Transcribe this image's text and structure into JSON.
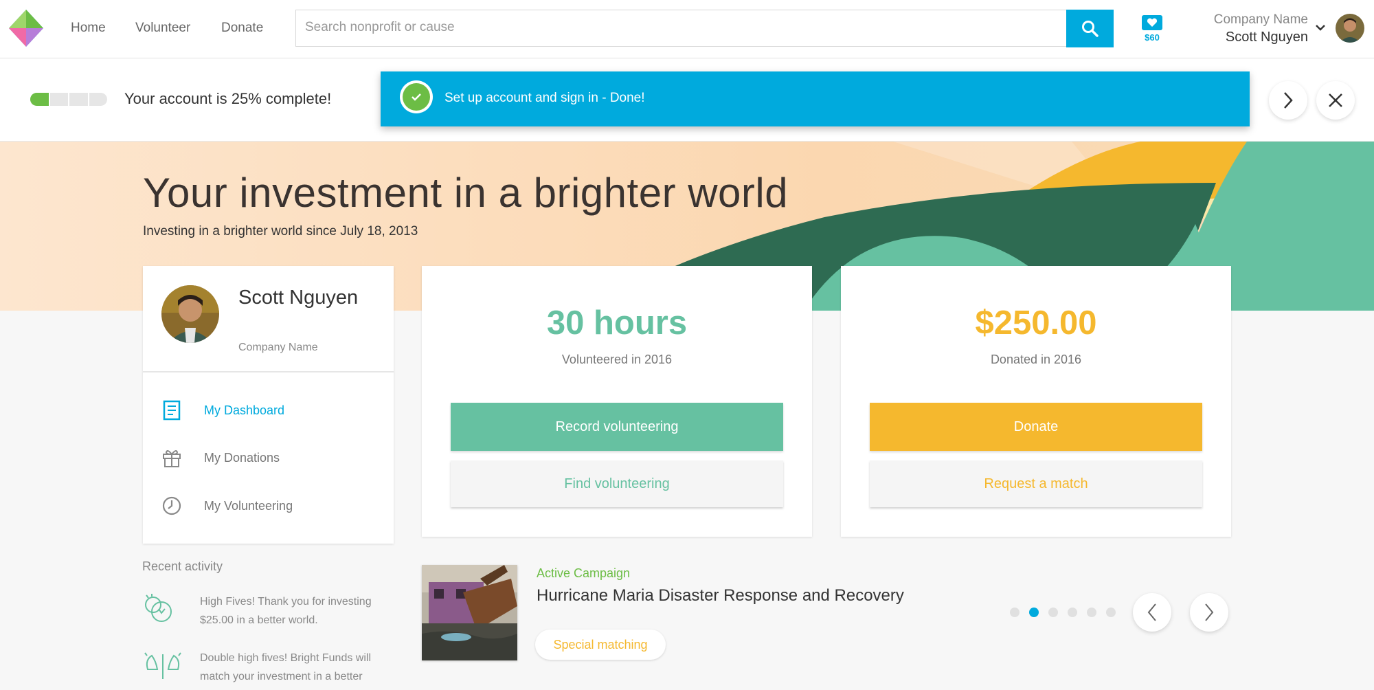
{
  "nav": {
    "links": [
      "Home",
      "Volunteer",
      "Donate"
    ],
    "search_placeholder": "Search nonprofit or cause",
    "wallet_amount": "$60",
    "company": "Company Name",
    "user_name": "Scott Nguyen"
  },
  "progress": {
    "text": "Your account is 25% complete!",
    "fraction_complete": 0.25,
    "toast": "Set up account and sign in - Done!"
  },
  "hero": {
    "title": "Your investment in a brighter world",
    "subtitle": "Investing in a brighter world since July 18, 2013"
  },
  "profile": {
    "name": "Scott Nguyen",
    "company": "Company Name",
    "menu": [
      {
        "label": "My Dashboard",
        "icon": "dashboard-icon",
        "active": true
      },
      {
        "label": "My Donations",
        "icon": "gift-icon",
        "active": false
      },
      {
        "label": "My Volunteering",
        "icon": "clock-icon",
        "active": false
      }
    ]
  },
  "volunteer": {
    "value": "30 hours",
    "label": "Volunteered in 2016",
    "primary_button": "Record volunteering",
    "secondary_button": "Find volunteering",
    "color": "#66c1a1"
  },
  "donation": {
    "value": "$250.00",
    "label": "Donated in 2016",
    "primary_button": "Donate",
    "secondary_button": "Request a match",
    "color": "#f5b82e"
  },
  "recent_activity": {
    "title": "Recent activity",
    "items": [
      {
        "text": "High Fives! Thank you for investing $25.00 in a better world.",
        "icon": "high-five-icon"
      },
      {
        "text": "Double high fives! Bright Funds will match your investment in a better",
        "icon": "double-high-five-icon"
      }
    ]
  },
  "campaign": {
    "tag": "Active Campaign",
    "title": "Hurricane Maria Disaster Response and Recovery",
    "pill": "Special matching",
    "dots_total": 6,
    "dots_active": 1
  },
  "colors": {
    "accent_blue": "#00aadd",
    "green": "#6cbd45",
    "teal": "#66c1a1",
    "gold": "#f5b82e"
  }
}
